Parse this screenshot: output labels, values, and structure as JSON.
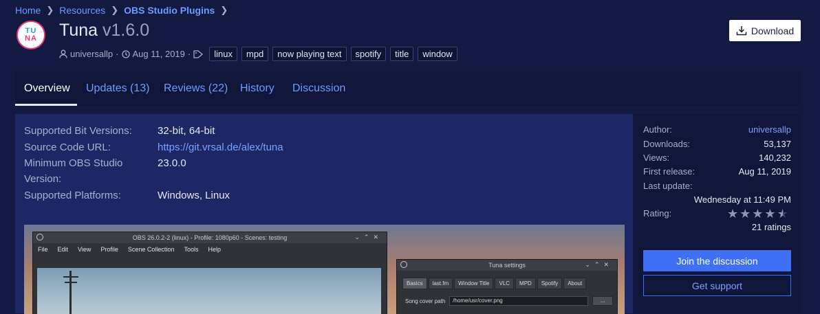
{
  "breadcrumb": {
    "items": [
      "Home",
      "Resources",
      "OBS Studio Plugins"
    ]
  },
  "logo": {
    "line1": "TU",
    "line2": "NA"
  },
  "resource": {
    "name": "Tuna",
    "version": "v1.6.0",
    "author": "universallp",
    "date": "Aug 11, 2019",
    "tags": [
      "linux",
      "mpd",
      "now playing text",
      "spotify",
      "title",
      "window"
    ]
  },
  "download_button": {
    "label": "Download"
  },
  "tabs": [
    "Overview",
    "Updates (13)",
    "Reviews (22)",
    "History",
    "Discussion"
  ],
  "fields": {
    "bit_versions": {
      "label": "Supported Bit Versions:",
      "value": "32-bit, 64-bit"
    },
    "source_url": {
      "label": "Source Code URL:",
      "value": "https://git.vrsal.de/alex/tuna"
    },
    "min_obs": {
      "label_line1": "Minimum OBS Studio",
      "label_line2": "Version:",
      "value": "23.0.0"
    },
    "platforms": {
      "label": "Supported Platforms:",
      "value": "Windows, Linux"
    }
  },
  "screenshot": {
    "obs_title": "OBS 26.0.2-2 (linux) - Profile: 1080p60 - Scenes: testing",
    "obs_menu": [
      "File",
      "Edit",
      "View",
      "Profile",
      "Scene Collection",
      "Tools",
      "Help"
    ],
    "tuna_title": "Tuna settings",
    "tuna_tabs": [
      "Basics",
      "last.fm",
      "Window Title",
      "VLC",
      "MPD",
      "Spotify",
      "About"
    ],
    "tuna_field_label": "Song cover path",
    "tuna_field_value": "/home/usr/cover.png",
    "tuna_browse": "..."
  },
  "sidebar": {
    "author_label": "Author:",
    "author_value": "universallp",
    "downloads_label": "Downloads:",
    "downloads_value": "53,137",
    "views_label": "Views:",
    "views_value": "140,232",
    "first_release_label": "First release:",
    "first_release_value": "Aug 11, 2019",
    "last_update_label": "Last update:",
    "last_update_value": "Wednesday at 11:49 PM",
    "rating_label": "Rating:",
    "rating_value": 4.5,
    "rating_count": "21 ratings"
  },
  "buttons": {
    "join": "Join the discussion",
    "support": "Get support"
  },
  "colors": {
    "background": "#131940",
    "panel": "#1e2766",
    "accent": "#3e6ff5",
    "link": "#78a2ff"
  }
}
